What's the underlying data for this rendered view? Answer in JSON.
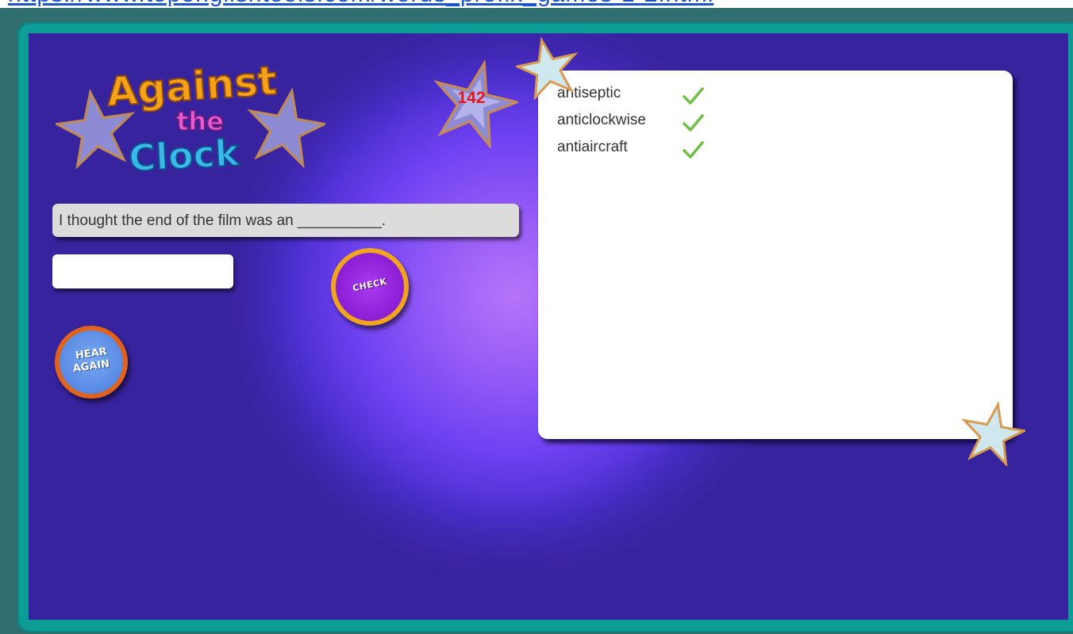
{
  "browser": {
    "url_fragment": "https://www.topenglishtools.com/words_prefix_games-1-2.html"
  },
  "game": {
    "logo": {
      "line1": "Against",
      "line2": "the",
      "line3": "Clock"
    },
    "score": "142",
    "sentence": "I thought the end of the film was an __________.",
    "answer": {
      "value": "",
      "placeholder": ""
    },
    "check_label": "CHECK",
    "hear_again": {
      "line1": "HEAR",
      "line2": "AGAIN"
    },
    "words": [
      {
        "word": "antiseptic",
        "status": "correct"
      },
      {
        "word": "anticlockwise",
        "status": "correct"
      },
      {
        "word": "antiaircraft",
        "status": "correct"
      }
    ]
  },
  "colors": {
    "frame": "#0d9c96",
    "stage_dark": "#38239e",
    "stage_glow": "#b574f8",
    "score": "#e3181a",
    "tick": "#6fbf45",
    "check_button": "#8f22d8",
    "hear_button": "#5a8ce6",
    "logo_against": "#f5a21a",
    "logo_the": "#e85ad8",
    "logo_clock": "#3ab8e8"
  },
  "icons": {
    "tick": "check-mark-icon",
    "star": "star-icon"
  }
}
